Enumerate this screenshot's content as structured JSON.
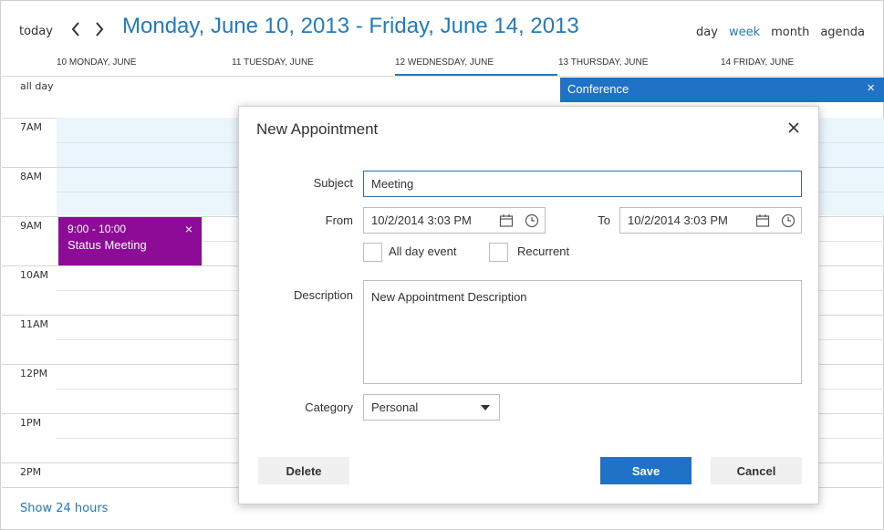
{
  "toolbar": {
    "today": "today",
    "range_title": "Monday, June 10, 2013 - Friday, June 14, 2013",
    "views": [
      "day",
      "week",
      "month",
      "agenda"
    ],
    "active_view": "week"
  },
  "day_headers": [
    "10 MONDAY, JUNE",
    "11 TUESDAY, JUNE",
    "12 WEDNESDAY, JUNE",
    "13 THURSDAY, JUNE",
    "14 FRIDAY, JUNE"
  ],
  "selected_day": "12 WEDNESDAY, JUNE",
  "allday": {
    "label": "all day",
    "event_title": "Conference",
    "close": "×"
  },
  "hours": [
    "7AM",
    "8AM",
    "9AM",
    "10AM",
    "11AM",
    "12PM",
    "1PM",
    "2PM"
  ],
  "event": {
    "time": "9:00 - 10:00",
    "title": "Status Meeting",
    "close": "×",
    "color": "#8e0b97"
  },
  "footer": {
    "show24": "Show 24 hours"
  },
  "dialog": {
    "title": "New Appointment",
    "subject_label": "Subject",
    "subject_value": "Meeting",
    "from_label": "From",
    "from_value": "10/2/2014 3:03 PM",
    "to_label": "To",
    "to_value": "10/2/2014 3:03 PM",
    "allday_label": "All day event",
    "recurrent_label": "Recurrent",
    "description_label": "Description",
    "description_value": "New Appointment Description",
    "category_label": "Category",
    "category_value": "Personal",
    "delete": "Delete",
    "save": "Save",
    "cancel": "Cancel"
  },
  "colors": {
    "accent": "#1f7cc1",
    "primary_button": "#1f72c6"
  }
}
